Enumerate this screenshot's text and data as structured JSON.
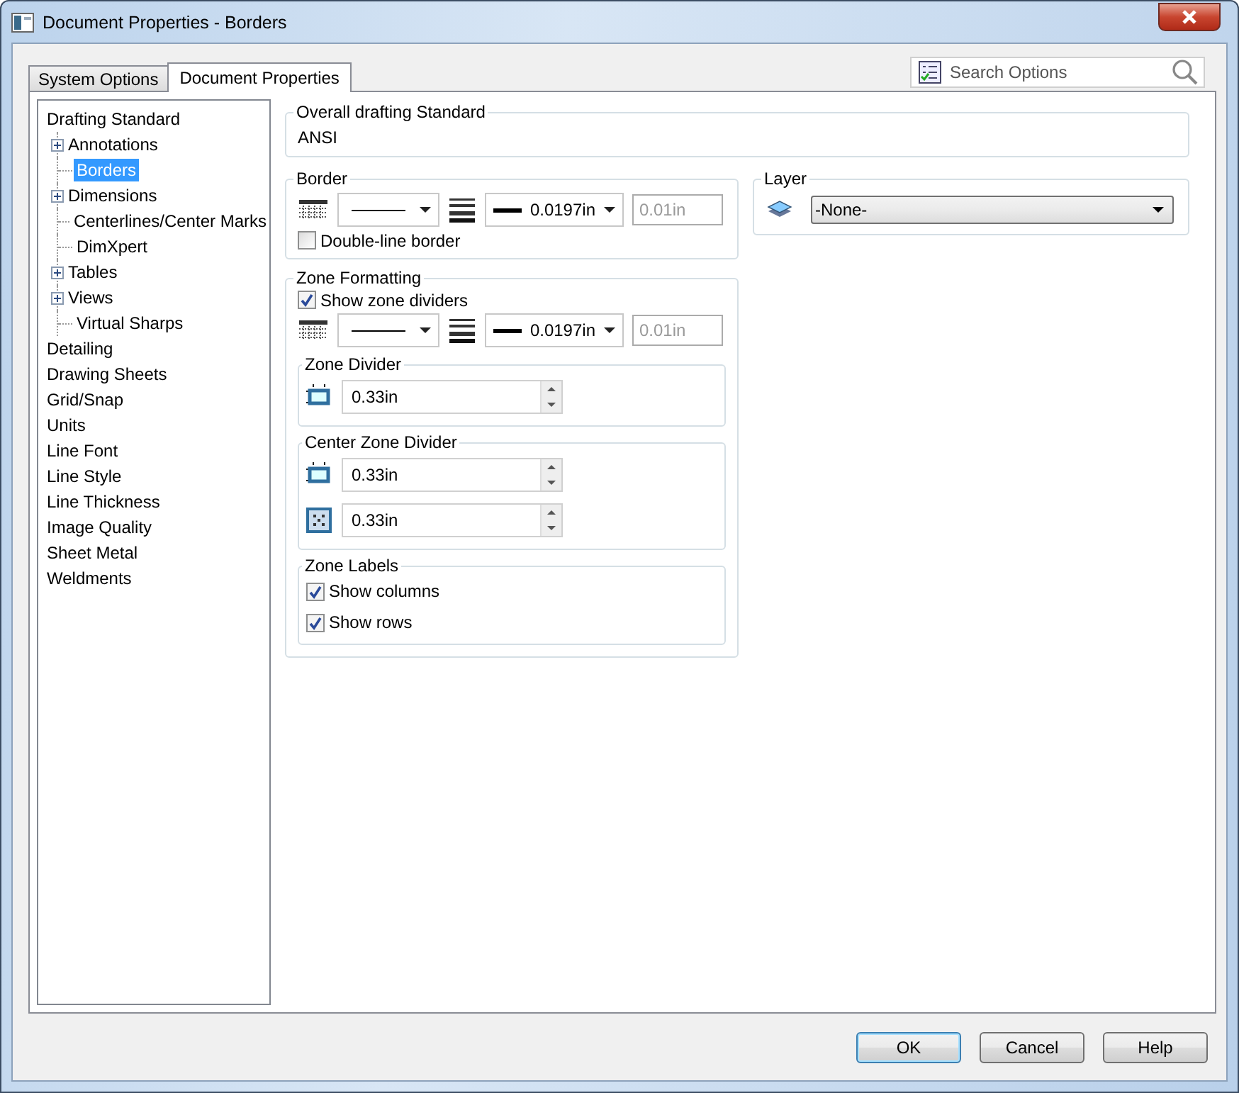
{
  "window": {
    "title": "Document Properties - Borders"
  },
  "tabs": [
    {
      "label": "System Options",
      "selected": false
    },
    {
      "label": "Document Properties",
      "selected": true
    }
  ],
  "search": {
    "placeholder": "Search Options"
  },
  "tree": [
    {
      "label": "Drafting Standard",
      "selected": false,
      "children": [
        {
          "label": "Annotations",
          "selected": false,
          "expandable": true
        },
        {
          "label": "Borders",
          "selected": true,
          "expandable": false
        },
        {
          "label": "Dimensions",
          "selected": false,
          "expandable": true
        },
        {
          "label": "Centerlines/Center Marks",
          "selected": false,
          "expandable": false
        },
        {
          "label": "DimXpert",
          "selected": false,
          "expandable": false
        },
        {
          "label": "Tables",
          "selected": false,
          "expandable": true
        },
        {
          "label": "Views",
          "selected": false,
          "expandable": true
        },
        {
          "label": "Virtual Sharps",
          "selected": false,
          "expandable": false
        }
      ]
    },
    {
      "label": "Detailing",
      "selected": false
    },
    {
      "label": "Drawing Sheets",
      "selected": false
    },
    {
      "label": "Grid/Snap",
      "selected": false
    },
    {
      "label": "Units",
      "selected": false
    },
    {
      "label": "Line Font",
      "selected": false
    },
    {
      "label": "Line Style",
      "selected": false
    },
    {
      "label": "Line Thickness",
      "selected": false
    },
    {
      "label": "Image Quality",
      "selected": false
    },
    {
      "label": "Sheet Metal",
      "selected": false
    },
    {
      "label": "Weldments",
      "selected": false
    }
  ],
  "drafting_standard": {
    "title": "Overall drafting Standard",
    "value": "ANSI"
  },
  "border": {
    "title": "Border",
    "thickness": "0.0197in",
    "custom": {
      "value": "0.01in",
      "disabled": true
    },
    "double_line": {
      "label": "Double-line border",
      "checked": false
    }
  },
  "layer": {
    "title": "Layer",
    "value": "-None-"
  },
  "zone_formatting": {
    "title": "Zone Formatting",
    "show_dividers": {
      "label": "Show zone dividers",
      "checked": true
    },
    "thickness": "0.0197in",
    "custom": {
      "value": "0.01in",
      "disabled": true
    },
    "zone_divider": {
      "title": "Zone Divider",
      "value": "0.33in"
    },
    "center_zone_divider": {
      "title": "Center Zone Divider",
      "fields": [
        {
          "kind": "horizontal",
          "value": "0.33in"
        },
        {
          "kind": "cross",
          "value": "0.33in"
        }
      ]
    },
    "zone_labels": {
      "title": "Zone Labels",
      "options": [
        {
          "label": "Show columns",
          "checked": true
        },
        {
          "label": "Show rows",
          "checked": true
        }
      ]
    }
  },
  "buttons": [
    "OK",
    "Cancel",
    "Help"
  ]
}
